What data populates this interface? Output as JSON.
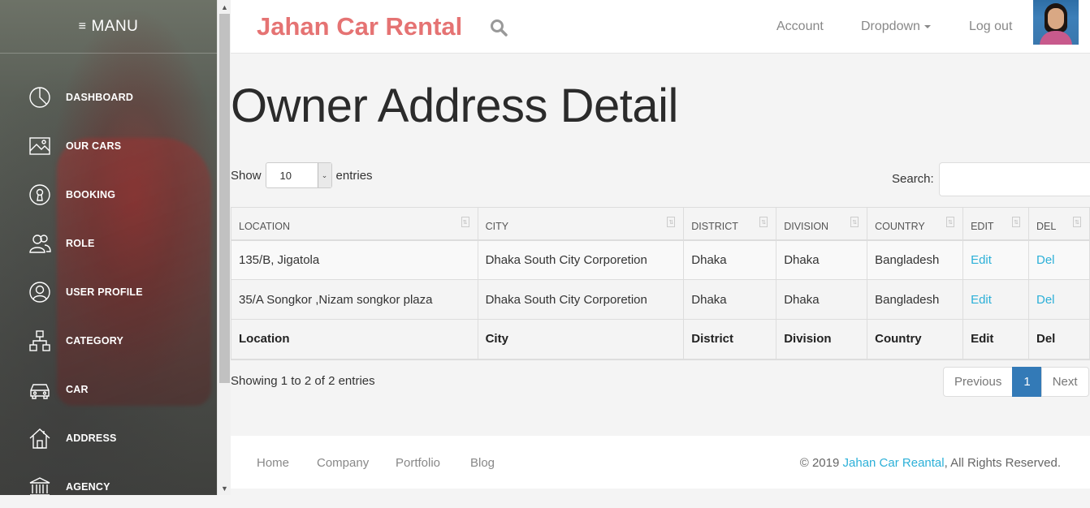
{
  "sidebar": {
    "menu_label": "MANU",
    "items": [
      {
        "label": "DASHBOARD",
        "icon": "pie-chart-icon"
      },
      {
        "label": "OUR CARS",
        "icon": "image-icon"
      },
      {
        "label": "BOOKING",
        "icon": "keyhole-icon"
      },
      {
        "label": "ROLE",
        "icon": "users-icon"
      },
      {
        "label": "USER PROFILE",
        "icon": "user-circle-icon"
      },
      {
        "label": "CATEGORY",
        "icon": "sitemap-icon"
      },
      {
        "label": "CAR",
        "icon": "car-icon"
      },
      {
        "label": "ADDRESS",
        "icon": "home-icon"
      },
      {
        "label": "AGENCY",
        "icon": "bank-icon"
      }
    ]
  },
  "topbar": {
    "brand": "Jahan Car Rental",
    "account": "Account",
    "dropdown": "Dropdown",
    "logout": "Log out"
  },
  "page": {
    "title": "Owner Address Detail"
  },
  "table_controls": {
    "show_label": "Show",
    "entries_label": "entries",
    "page_size": "10",
    "search_label": "Search:",
    "search_value": ""
  },
  "table": {
    "headers": [
      "LOCATION",
      "CITY",
      "DISTRICT",
      "DIVISION",
      "COUNTRY",
      "EDIT",
      "DEL"
    ],
    "rows": [
      {
        "location": "135/B, Jigatola",
        "city": "Dhaka South City Corporetion",
        "district": "Dhaka",
        "division": "Dhaka",
        "country": "Bangladesh",
        "edit": "Edit",
        "del": "Del"
      },
      {
        "location": "35/A Songkor ,Nizam songkor plaza",
        "city": "Dhaka South City Corporetion",
        "district": "Dhaka",
        "division": "Dhaka",
        "country": "Bangladesh",
        "edit": "Edit",
        "del": "Del"
      }
    ],
    "footer": [
      "Location",
      "City",
      "District",
      "Division",
      "Country",
      "Edit",
      "Del"
    ]
  },
  "pagination": {
    "info": "Showing 1 to 2 of 2 entries",
    "previous": "Previous",
    "current": "1",
    "next": "Next"
  },
  "footer": {
    "links": [
      "Home",
      "Company",
      "Portfolio",
      "Blog"
    ],
    "copyright_prefix": "© 2019 ",
    "copyright_link": "Jahan Car Reantal",
    "copyright_suffix": ", All Rights Reserved."
  },
  "colors": {
    "brand": "#e57373",
    "link": "#2cb0d8",
    "active_page": "#337ab7"
  }
}
